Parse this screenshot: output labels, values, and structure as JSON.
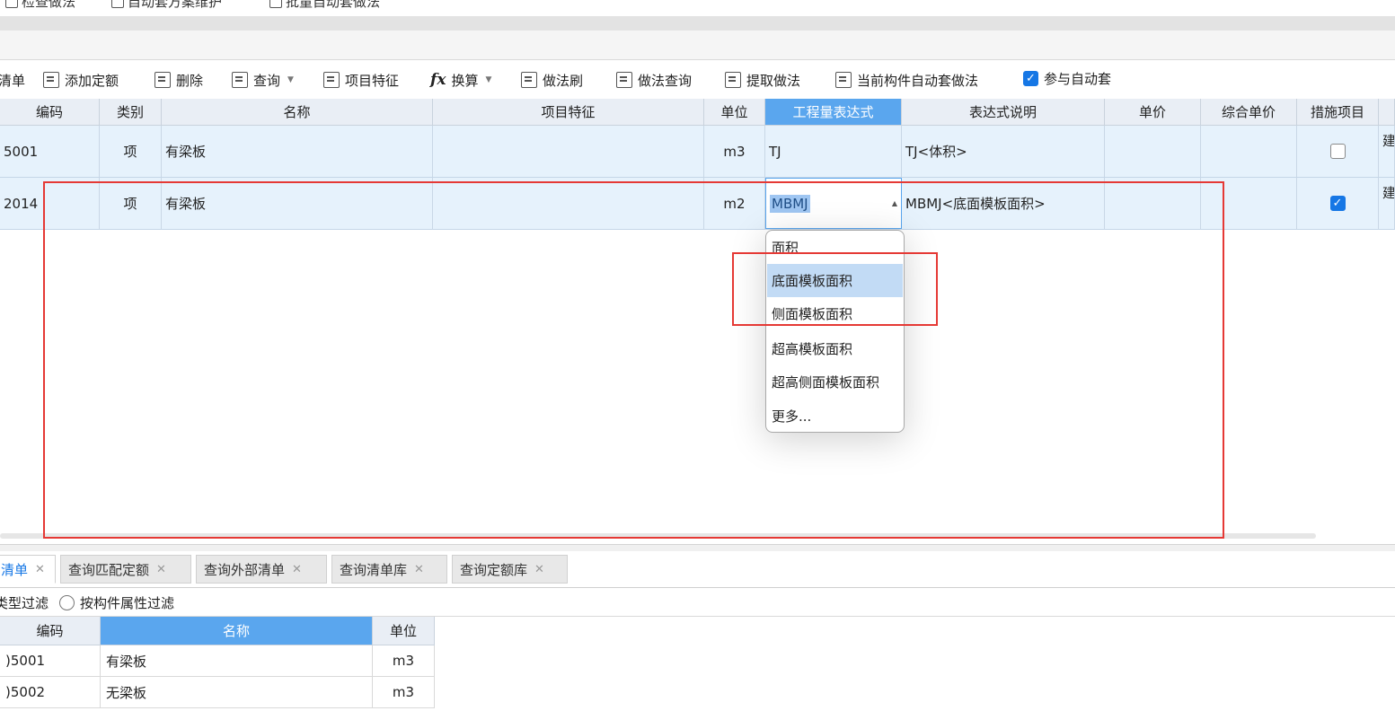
{
  "top_toolbar": {
    "items": [
      {
        "label": "检查做法",
        "icon": "check-method-icon"
      },
      {
        "label": "自动套方案维护",
        "icon": "auto-scheme-icon"
      },
      {
        "label": "批量自动套做法",
        "icon": "batch-auto-icon"
      }
    ]
  },
  "main_toolbar": {
    "items": [
      {
        "label": "清单"
      },
      {
        "label": "添加定额",
        "icon": "add-quota-icon"
      },
      {
        "label": "删除",
        "icon": "trash-icon"
      },
      {
        "label": "查询",
        "icon": "query-icon",
        "dropdown": true
      },
      {
        "label": "项目特征",
        "icon": "feature-icon"
      },
      {
        "label": "换算",
        "icon": "fx-icon",
        "glyph": "fx",
        "dropdown": true
      },
      {
        "label": "做法刷",
        "icon": "method-brush-icon"
      },
      {
        "label": "做法查询",
        "icon": "method-query-icon"
      },
      {
        "label": "提取做法",
        "icon": "extract-method-icon"
      },
      {
        "label": "当前构件自动套做法",
        "icon": "current-component-icon"
      }
    ],
    "auto_checkbox_label": "参与自动套",
    "auto_checkbox_checked": true
  },
  "grid": {
    "columns": [
      "编码",
      "类别",
      "名称",
      "项目特征",
      "单位",
      "工程量表达式",
      "表达式说明",
      "单价",
      "综合单价",
      "措施项目"
    ],
    "selected_column": "工程量表达式",
    "rows": [
      {
        "code": "5001",
        "type": "项",
        "name": "有梁板",
        "feature": "",
        "unit": "m3",
        "expr": "TJ",
        "expr_desc": "TJ<体积>",
        "price": "",
        "comp_price": "",
        "measure": false,
        "extra": "建"
      },
      {
        "code": "2014",
        "type": "项",
        "name": "有梁板",
        "feature": "",
        "unit": "m2",
        "expr": "MBMJ",
        "expr_desc": "MBMJ<底面模板面积>",
        "price": "",
        "comp_price": "",
        "measure": true,
        "extra": "建"
      }
    ]
  },
  "expr_dropdown": {
    "items": [
      "面积",
      "底面模板面积",
      "侧面模板面积",
      "超高模板面积",
      "超高侧面模板面积",
      "更多..."
    ],
    "highlighted": "底面模板面积"
  },
  "bottom_tabs": [
    {
      "label": "清单",
      "active": true
    },
    {
      "label": "查询匹配定额",
      "active": false
    },
    {
      "label": "查询外部清单",
      "active": false
    },
    {
      "label": "查询清单库",
      "active": false
    },
    {
      "label": "查询定额库",
      "active": false
    }
  ],
  "filter": {
    "type_filter_label": "类型过滤",
    "attr_filter_label": "按构件属性过滤"
  },
  "lib_table": {
    "columns": [
      "编码",
      "名称",
      "单位"
    ],
    "selected_column": "名称",
    "rows": [
      {
        "code": ")5001",
        "name": "有梁板",
        "unit": "m3"
      },
      {
        "code": ")5002",
        "name": "无梁板",
        "unit": "m3"
      }
    ]
  },
  "colors": {
    "accent": "#1677e5",
    "header_selected": "#5aa6ee",
    "row_bg": "#e6f2fc",
    "annotation_red": "#e53935",
    "dropdown_highlight": "#c2dbf5"
  }
}
